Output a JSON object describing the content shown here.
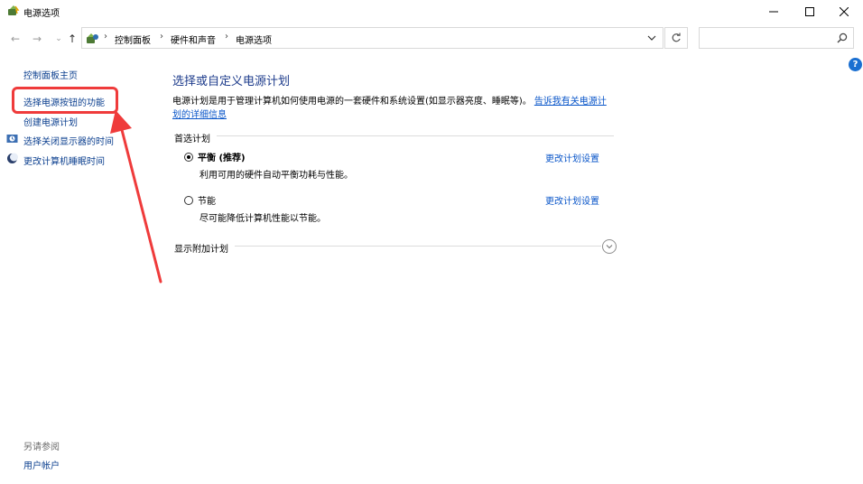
{
  "window": {
    "title": "电源选项",
    "controls": [
      "minimize-icon",
      "maximize-icon",
      "close-icon"
    ]
  },
  "navigation": {
    "back_icon": "←",
    "forward_icon": "→",
    "recent_icon": "⌄",
    "up_icon": "↑",
    "breadcrumbs": [
      "控制面板",
      "硬件和声音",
      "电源选项"
    ],
    "separator": "›",
    "search": {
      "placeholder": "",
      "value": ""
    }
  },
  "help": {
    "label": "?"
  },
  "sidebar": {
    "items": [
      {
        "label": "控制面板主页",
        "icon": null
      },
      {
        "label": "选择电源按钮的功能",
        "icon": null,
        "highlighted": true
      },
      {
        "label": "创建电源计划",
        "icon": null
      },
      {
        "label": "选择关闭显示器的时间",
        "icon": "clock-icon"
      },
      {
        "label": "更改计算机睡眠时间",
        "icon": "moon-icon"
      }
    ],
    "see_also": {
      "label": "另请参阅",
      "items": [
        {
          "label": "用户帐户"
        }
      ]
    }
  },
  "main": {
    "title": "选择或自定义电源计划",
    "description": "电源计划是用于管理计算机如何使用电源的一套硬件和系统设置(如显示器亮度、睡眠等)。",
    "description_link_1": "告诉我有关电源计",
    "description_link_2": "划的详细信息",
    "preferred_label": "首选计划",
    "plans": [
      {
        "name": "平衡 (推荐)",
        "desc": "利用可用的硬件自动平衡功耗与性能。",
        "link": "更改计划设置",
        "selected": true
      },
      {
        "name": "节能",
        "desc": "尽可能降低计算机性能以节能。",
        "link": "更改计划设置",
        "selected": false
      }
    ],
    "extra_plans_label": "显示附加计划"
  },
  "colors": {
    "accent_title": "#1e3c8c",
    "link": "#0a56c9",
    "sidebar_link": "#0b3f8f",
    "annotation": "#ef3b3b"
  }
}
